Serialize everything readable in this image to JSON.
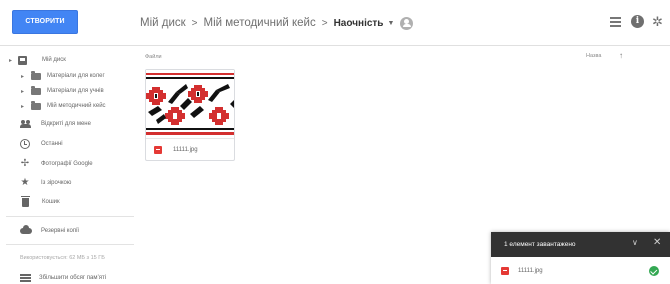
{
  "header": {
    "create_button": "СТВОРИТИ",
    "breadcrumb": [
      "Мій диск",
      "Мій методичний кейс"
    ],
    "current_folder": "Наочність"
  },
  "sidebar": {
    "my_drive": "Мій диск",
    "folders": [
      "Матеріали для колег",
      "Матеріали для учнів",
      "Мій методичний кейс"
    ],
    "items": [
      {
        "icon": "people-icon",
        "label": "Відкриті для мене"
      },
      {
        "icon": "clock-icon",
        "label": "Останні"
      },
      {
        "icon": "pinwheel-icon",
        "label": "Фотографії Google"
      },
      {
        "icon": "star-icon",
        "label": "Із зірочкою"
      },
      {
        "icon": "trash-icon",
        "label": "Кошик"
      }
    ],
    "backups": "Резервні копії",
    "storage_text": "Використовується: 62 МБ з 15 ГБ",
    "upgrade_storage": "Збільшити обсяг пам’яті"
  },
  "main": {
    "files_label": "Файли",
    "sort_label": "Назва",
    "files": [
      {
        "name": "11111.jpg",
        "thumbnail": "embroidery-pattern"
      }
    ]
  },
  "upload_toast": {
    "title": "1 елемент завантажено",
    "file_name": "11111.jpg",
    "status": "complete"
  },
  "colors": {
    "accent": "#4285f4",
    "toast_bg": "#323232",
    "success": "#34a853",
    "image_file": "#e53935",
    "embroidery_red": "#d32f2f",
    "embroidery_black": "#111111"
  }
}
